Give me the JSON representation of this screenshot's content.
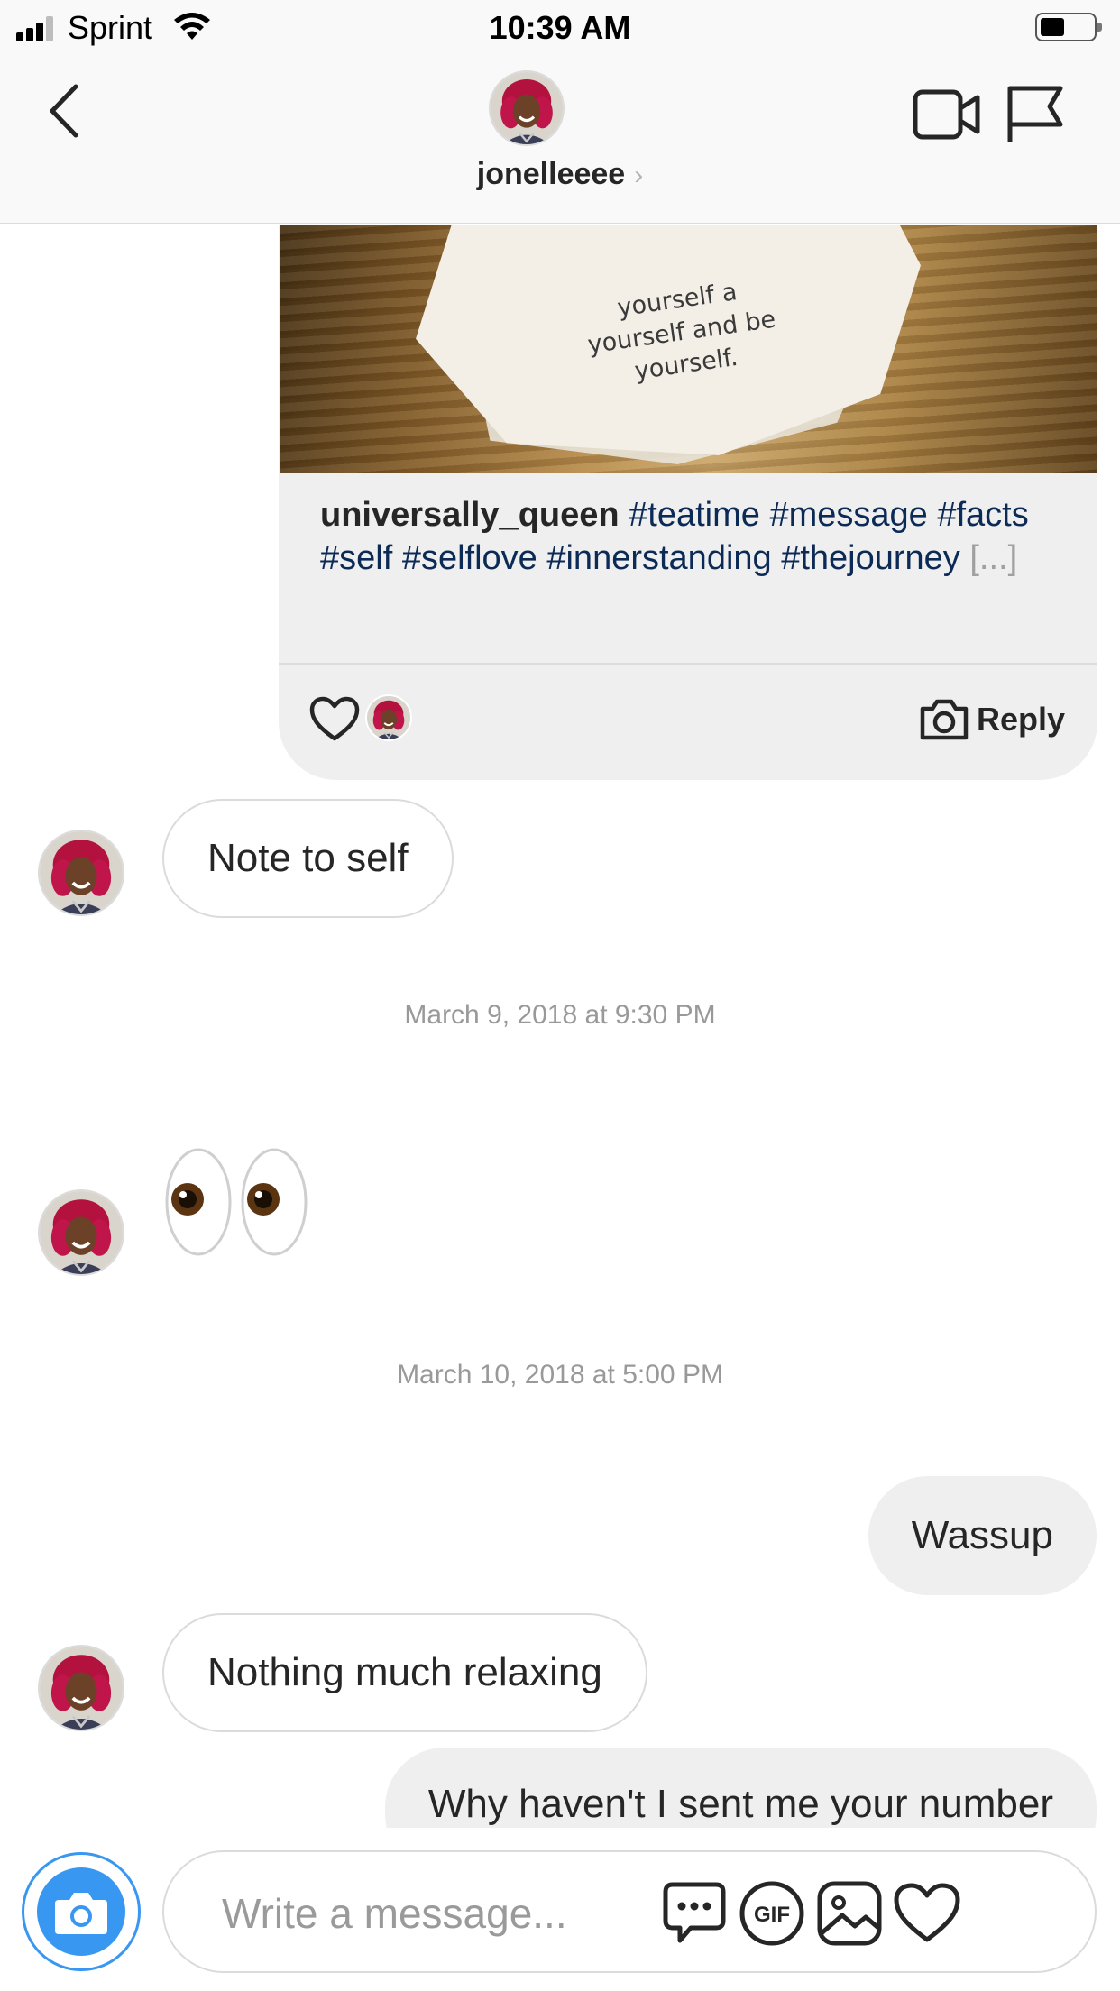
{
  "status_bar": {
    "carrier": "Sprint",
    "time": "10:39 AM"
  },
  "header": {
    "username": "jonelleeee",
    "chevron": "›"
  },
  "shared_post": {
    "image_text": [
      "yourself a",
      "yourself and be",
      "yourself."
    ],
    "author": "universally_queen",
    "hashtags": "#teatime #message #facts #self #selflove #innerstanding #thejourney",
    "more": "[...]",
    "reply_label": "Reply"
  },
  "messages": {
    "note_to_self": "Note to self",
    "timestamp_1": "March 9, 2018 at 9:30 PM",
    "eyes_emoji_icon": "eyes-emoji",
    "timestamp_2": "March 10, 2018 at 5:00 PM",
    "wassup": "Wassup",
    "nothing_much": "Nothing much relaxing",
    "number_question": "Why haven't I sent me your number"
  },
  "composer": {
    "placeholder": "Write a message..."
  },
  "colors": {
    "accent": "#3897f0",
    "hashtag": "#0b2a55",
    "bubble_out": "#efefef",
    "border": "#dbdbdb"
  }
}
